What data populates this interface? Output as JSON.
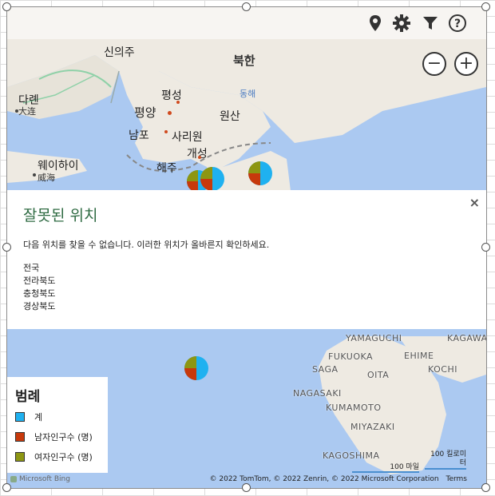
{
  "toolbar": {
    "icons": [
      "map-pin-icon",
      "gear-icon",
      "filter-icon",
      "help-icon"
    ]
  },
  "map": {
    "labels": {
      "sinuiju": "신의주",
      "north_korea": "북한",
      "dalian_ko": "다롄",
      "dalian_zh": "大连",
      "pyongseong": "평성",
      "east_sea": "동해",
      "pyongyang": "평양",
      "wonsan": "원산",
      "nampo": "남포",
      "sariwon": "사리원",
      "kaesong": "개성",
      "weihai_ko": "웨이하이",
      "weihai_zh": "威海",
      "haeju": "해주",
      "yamaguchi": "YAMAGUCHI",
      "kagawa": "KAGAWA",
      "fukuoka": "FUKUOKA",
      "ehime": "EHIME",
      "saga": "SAGA",
      "oita": "OITA",
      "kochi": "KOCHI",
      "nagasaki": "NAGASAKI",
      "kumamoto": "KUMAMOTO",
      "miyazaki": "MIYAZAKI",
      "kagoshima": "KAGOSHIMA"
    },
    "zoom_out_symbol": "−",
    "zoom_in_symbol": "+",
    "scale_miles": "100 마일",
    "scale_km": "100 킬로미터",
    "attribution": "© 2022 TomTom, © 2022 Zenrin, © 2022 Microsoft Corporation",
    "terms": "Terms",
    "bing": "Microsoft Bing"
  },
  "dialog": {
    "title": "잘못된 위치",
    "close": "×",
    "message": "다음 위치를 찾을 수 없습니다. 이러한 위치가 올바른지 확인하세요.",
    "locations": [
      "전국",
      "전라북도",
      "충청북도",
      "경상북도"
    ]
  },
  "legend": {
    "title": "범례",
    "items": [
      {
        "label": "계",
        "color": "#1fb1f0"
      },
      {
        "label": "남자인구수 (명)",
        "color": "#c7390c"
      },
      {
        "label": "여자인구수 (명)",
        "color": "#8d9613"
      }
    ]
  },
  "colors": {
    "series_total": "#1fb1f0",
    "series_male": "#c7390c",
    "series_female": "#8d9613",
    "title_green": "#2f6b43",
    "water": "#abc9f1",
    "land": "#eeeae2"
  }
}
